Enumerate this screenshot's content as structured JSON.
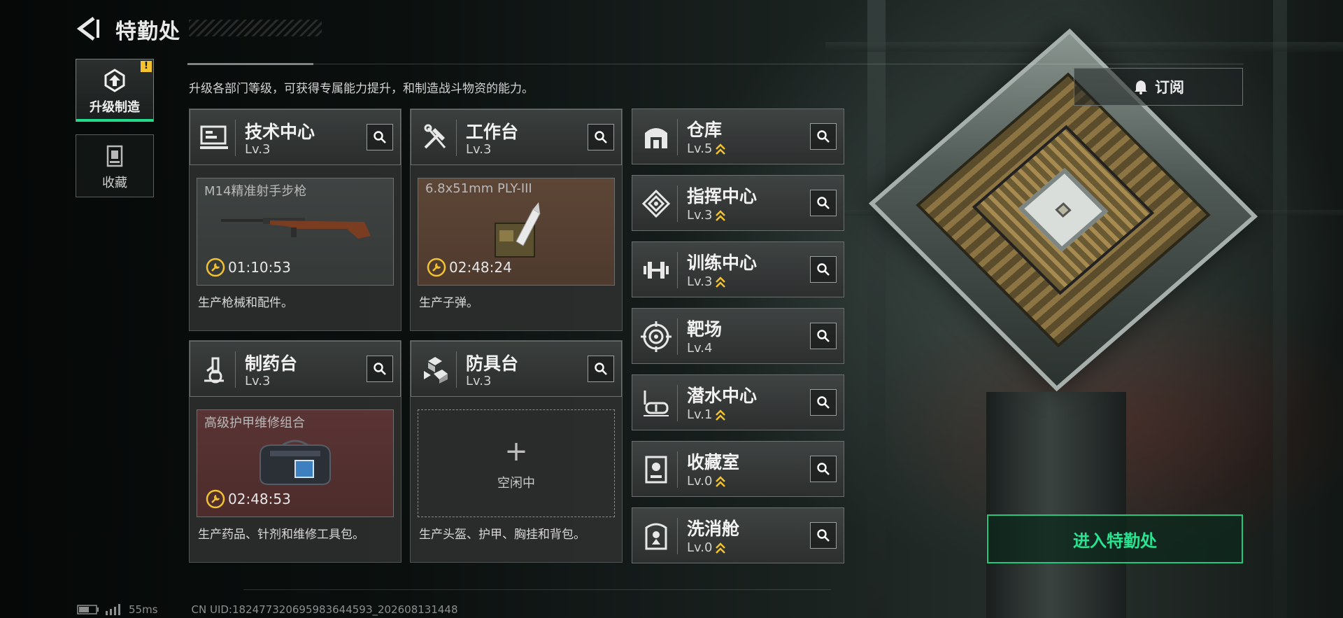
{
  "header": {
    "title": "特勤处"
  },
  "subtitle": "升级各部门等级，可获得专属能力提升，和制造战斗物资的能力。",
  "nav": {
    "items": [
      {
        "label": "升级制造",
        "badge": "!"
      },
      {
        "label": "收藏"
      }
    ]
  },
  "facilities_main": [
    {
      "name": "技术中心",
      "level": "Lv.3",
      "item": "M14精准射手步枪",
      "timer": "01:10:53",
      "desc": "生产枪械和配件。"
    },
    {
      "name": "工作台",
      "level": "Lv.3",
      "item": "6.8x51mm PLY-III",
      "timer": "02:48:24",
      "desc": "生产子弹。"
    },
    {
      "name": "制药台",
      "level": "Lv.3",
      "item": "高级护甲维修组合",
      "timer": "02:48:53",
      "desc": "生产药品、针剂和维修工具包。"
    },
    {
      "name": "防具台",
      "level": "Lv.3",
      "empty_plus": "+",
      "empty_label": "空闲中",
      "desc": "生产头盔、护甲、胸挂和背包。"
    }
  ],
  "facilities_side": [
    {
      "name": "仓库",
      "level": "Lv.5",
      "upgradable": true
    },
    {
      "name": "指挥中心",
      "level": "Lv.3",
      "upgradable": true
    },
    {
      "name": "训练中心",
      "level": "Lv.3",
      "upgradable": true
    },
    {
      "name": "靶场",
      "level": "Lv.4",
      "upgradable": false
    },
    {
      "name": "潜水中心",
      "level": "Lv.1",
      "upgradable": true
    },
    {
      "name": "收藏室",
      "level": "Lv.0",
      "upgradable": true
    },
    {
      "name": "洗消舱",
      "level": "Lv.0",
      "upgradable": true
    }
  ],
  "subscribe_label": "订阅",
  "enter_label": "进入特勤处",
  "footer": {
    "ping": "55ms",
    "uid": "CN UID:18247732069598364459З_202608131448"
  },
  "colors": {
    "accent_green": "#23d98a",
    "timer_yellow": "#f2c230",
    "badge_yellow": "#f2c230"
  }
}
